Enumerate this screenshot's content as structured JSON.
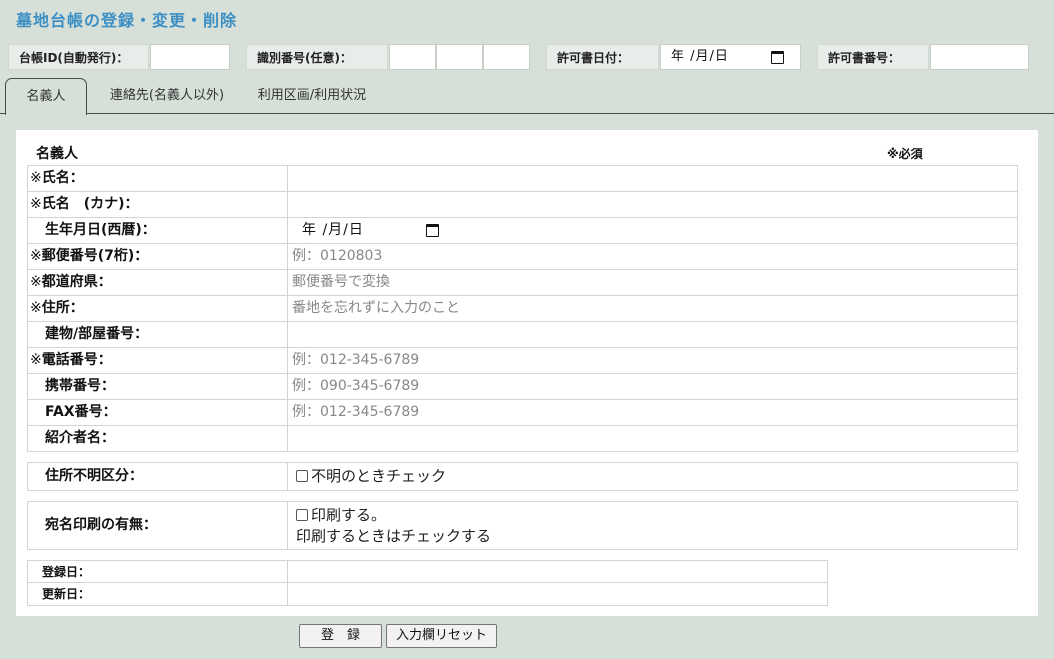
{
  "page": {
    "title": "墓地台帳の登録・変更・削除"
  },
  "header": {
    "ledger_id_label": "台帳ID(自動発行)：",
    "ident_label": "識別番号(任意)：",
    "permit_date_label": "許可書日付：",
    "permit_date_value": "年 /月/日",
    "permit_no_label": "許可書番号："
  },
  "tabs": [
    {
      "label": "名義人",
      "active": true
    },
    {
      "label": "連絡先(名義人以外)",
      "active": false
    },
    {
      "label": "利用区画/利用状況",
      "active": false
    }
  ],
  "section": {
    "title": "名義人",
    "required_note": "※必須"
  },
  "fields": [
    {
      "mark": "※",
      "label": "氏名：",
      "value": ""
    },
    {
      "mark": "※",
      "label": "氏名　(カナ)：",
      "value": ""
    },
    {
      "mark": "",
      "label": "生年月日(西暦)：",
      "value": "年 /月/日"
    },
    {
      "mark": "※",
      "label": "郵便番号(7桁)：",
      "value": "例：0120803"
    },
    {
      "mark": "※",
      "label": "都道府県：",
      "value": "郵便番号で変換"
    },
    {
      "mark": "※",
      "label": "住所：",
      "value": "番地を忘れずに入力のこと"
    },
    {
      "mark": "",
      "label": "建物/部屋番号：",
      "value": ""
    },
    {
      "mark": "※",
      "label": "電話番号：",
      "value": "例：012-345-6789"
    },
    {
      "mark": "",
      "label": "携帯番号：",
      "value": "例：090-345-6789"
    },
    {
      "mark": "",
      "label": "FAX番号：",
      "value": "例：012-345-6789"
    },
    {
      "mark": "",
      "label": "紹介者名：",
      "value": ""
    }
  ],
  "unknown_address": {
    "label": "住所不明区分：",
    "checkbox_label": "不明のときチェック",
    "checked": false
  },
  "print_label": {
    "label": "宛名印刷の有無：",
    "checkbox_label": "印刷する。",
    "hint": "印刷するときはチェックする",
    "checked": false
  },
  "meta": {
    "registered_label": "登録日：",
    "updated_label": "更新日："
  },
  "buttons": {
    "register": "登　録",
    "reset": "入力欄リセット"
  }
}
